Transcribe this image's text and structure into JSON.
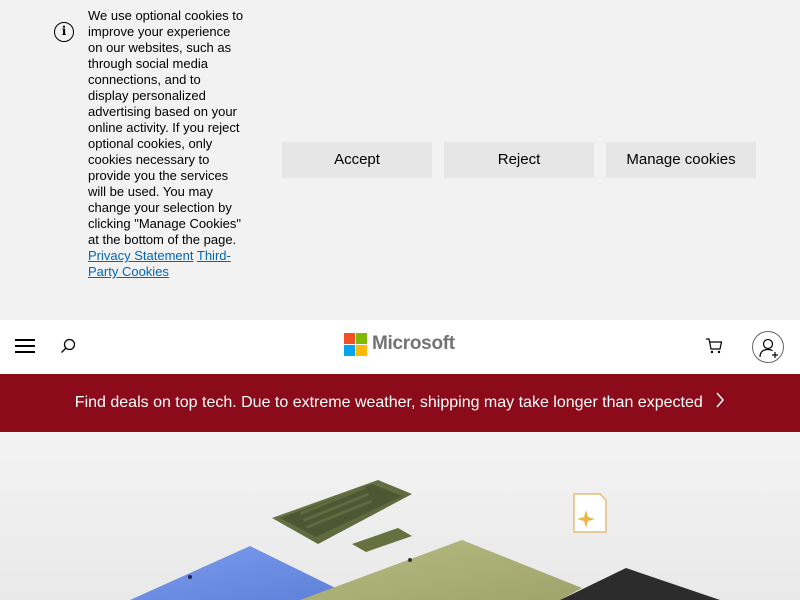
{
  "cookie_banner": {
    "info_icon": "info-icon",
    "text_before_links": "We use optional cookies to improve your experience on our websites, such as through social media connections, and to display personalized advertising based on your online activity. If you reject optional cookies, only cookies necessary to provide you the services will be used. You may change your selection by clicking \"Manage Cookies\" at the bottom of the page.",
    "privacy_link": "Privacy Statement",
    "third_party_link": "Third-Party Cookies",
    "accept_label": "Accept",
    "reject_label": "Reject",
    "manage_label": "Manage cookies"
  },
  "header": {
    "menu_icon": "hamburger-menu-icon",
    "search_icon": "search-icon",
    "logo_text": "Microsoft",
    "cart_icon": "cart-icon",
    "account_icon": "account-add-icon"
  },
  "deals_banner": {
    "text": "Find deals on top tech. Due to extreme weather, shipping may take longer than expected",
    "background": "#8c0b1a",
    "chevron_icon": "chevron-right-icon"
  },
  "hero": {
    "sparkle_icon": "ai-sparkle-icon"
  }
}
